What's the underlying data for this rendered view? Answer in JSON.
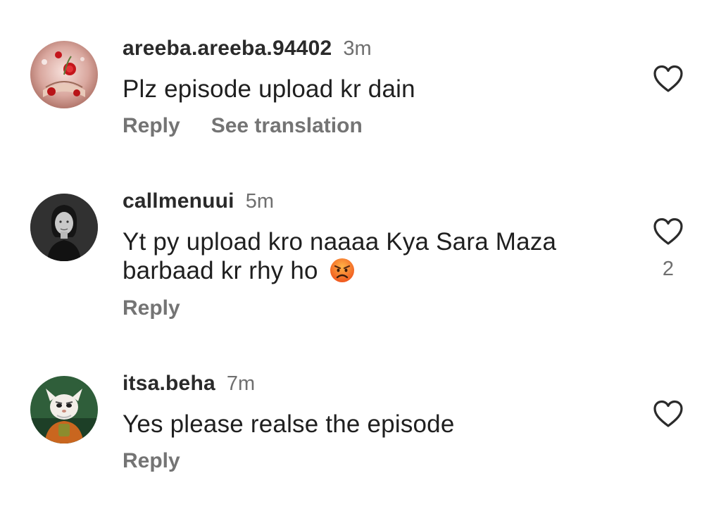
{
  "comments": [
    {
      "username": "areeba.areeba.94402",
      "time": "3m",
      "text": "Plz episode upload kr dain",
      "actions": [
        "Reply",
        "See translation"
      ],
      "like_count": "",
      "avatar_icon": "roses-book-avatar"
    },
    {
      "username": "callmenuui",
      "time": "5m",
      "text": "Yt py upload kro naaaa Kya Sara Maza barbaad kr rhy ho",
      "emoji": "angry-face-emoji",
      "actions": [
        "Reply"
      ],
      "like_count": "2",
      "avatar_icon": "portrait-avatar"
    },
    {
      "username": "itsa.beha",
      "time": "7m",
      "text": "Yes please realse the episode",
      "actions": [
        "Reply"
      ],
      "like_count": "",
      "avatar_icon": "cartoon-master-avatar"
    }
  ],
  "colors": {
    "username": "#2a2a2a",
    "secondary": "#747474",
    "heart_outline": "#2b2b2b"
  }
}
